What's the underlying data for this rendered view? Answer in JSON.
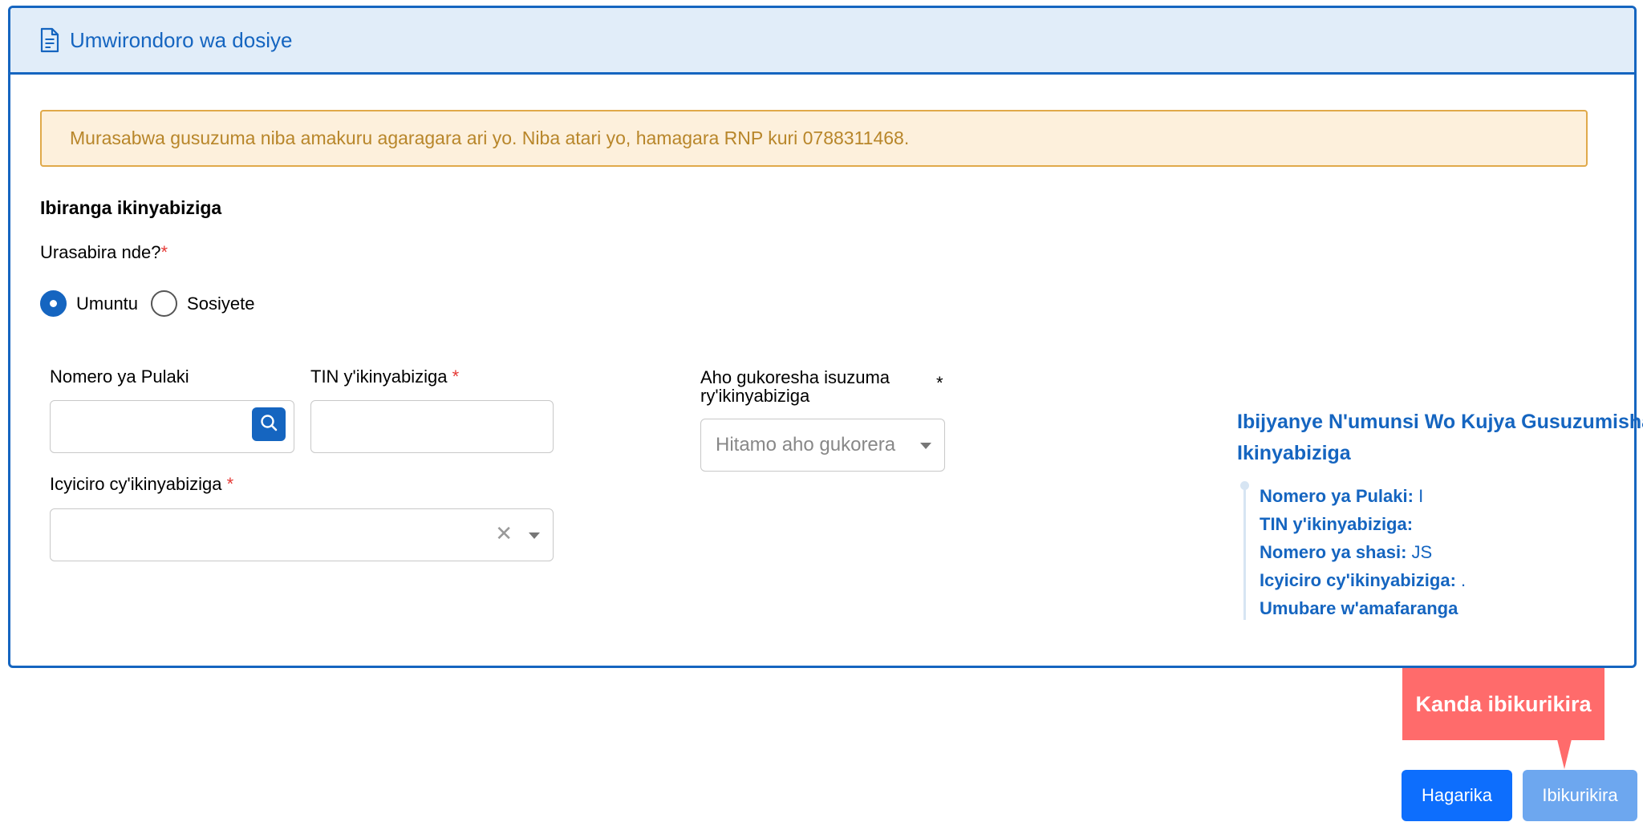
{
  "header": {
    "title": "Umwirondoro wa dosiye",
    "icon": "document-icon"
  },
  "alert": {
    "text": "Murasabwa gusuzuma niba amakuru agaragara ari yo. Niba atari yo, hamagara RNP kuri 0788311468."
  },
  "section": {
    "title": "Ibiranga ikinyabiziga"
  },
  "question": {
    "label": "Urasabira nde?",
    "required_mark": "*"
  },
  "radios": [
    {
      "label": "Umuntu",
      "checked": true
    },
    {
      "label": "Sosiyete",
      "checked": false
    }
  ],
  "fields": {
    "plate": {
      "label": "Nomero ya Pulaki",
      "value": ""
    },
    "tin": {
      "label": "TIN y'ikinyabiziga",
      "required_mark": "*",
      "value": ""
    },
    "location": {
      "label": "Aho gukoresha isuzuma ry'ikinyabiziga",
      "required_mark": "*",
      "placeholder": "Hitamo aho gukorera"
    },
    "category": {
      "label": "Icyiciro cy'ikinyabiziga",
      "required_mark": "*",
      "value": ""
    }
  },
  "info_panel": {
    "title": "Ibijyanye N'umunsi Wo Kujya Gusuzumisha Ikinyabiziga",
    "items": [
      {
        "label": "Nomero ya Pulaki:",
        "value": "I"
      },
      {
        "label": "TIN y'ikinyabiziga:",
        "value": ""
      },
      {
        "label": "Nomero ya shasi:",
        "value": "JS"
      },
      {
        "label": "Icyiciro cy'ikinyabiziga:",
        "value": "."
      },
      {
        "label": "Umubare w'amafaranga",
        "value": ""
      }
    ]
  },
  "tooltip": {
    "text": "Kanda ibikurikira"
  },
  "buttons": {
    "cancel": "Hagarika",
    "next": "Ibikurikira"
  },
  "colors": {
    "primary": "#1565c0",
    "alert_bg": "#fdf0dc",
    "alert_text": "#b8862a",
    "tooltip": "#ff6b6b",
    "required": "#e53935"
  }
}
